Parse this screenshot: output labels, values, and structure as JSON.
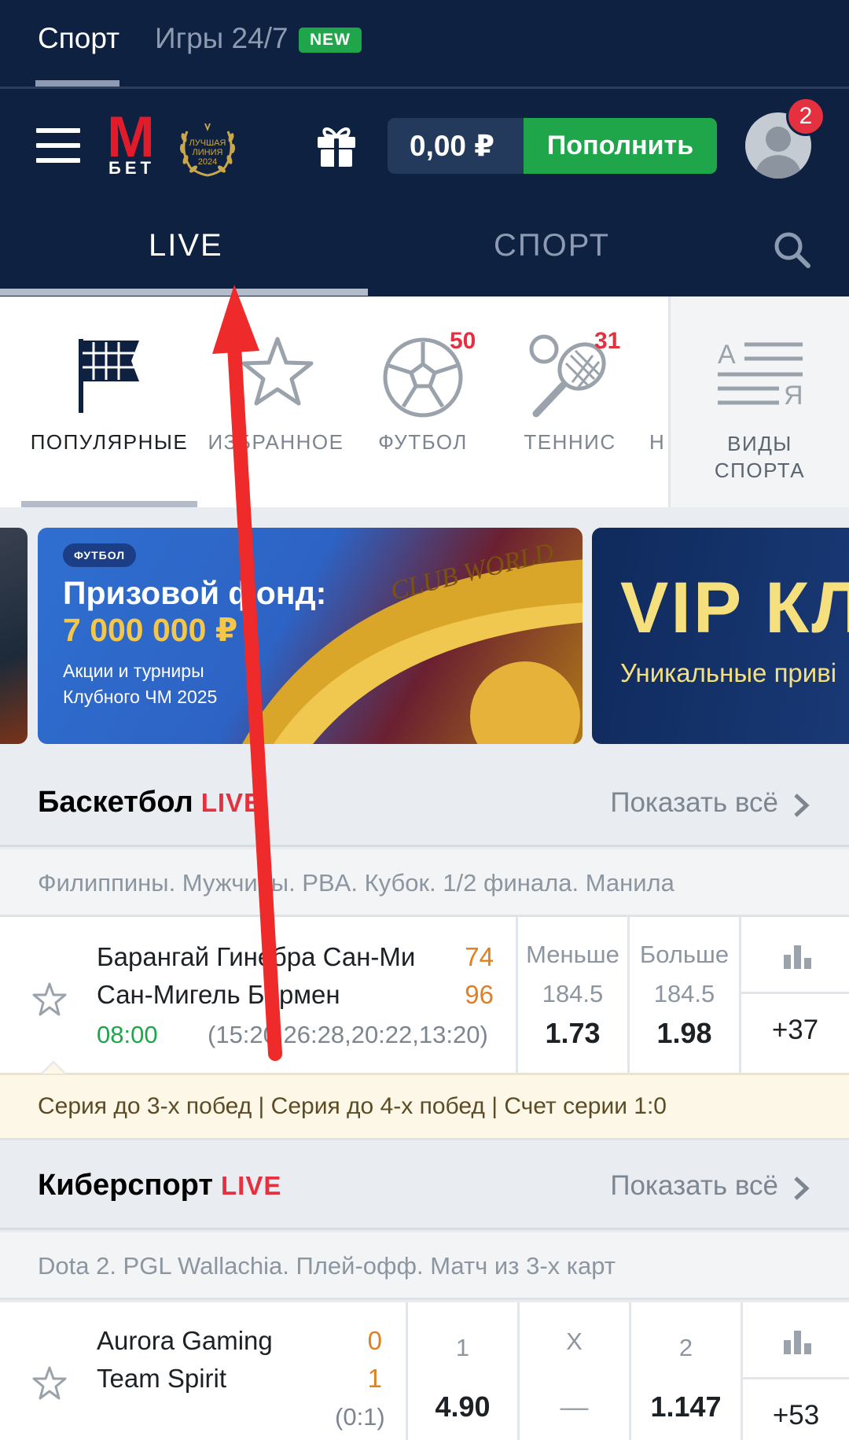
{
  "top_tabs": {
    "sport": "Спорт",
    "games": "Игры 24/7",
    "new_badge": "NEW"
  },
  "header": {
    "logo_m": "M",
    "logo_bet": "БЕТ",
    "award_text": "ЛУЧШАЯ ЛИНИЯ 2024",
    "balance": "0,00 ₽",
    "deposit_label": "Пополнить",
    "notification_count": "2",
    "tab_live": "LIVE",
    "tab_sport": "СПОРТ"
  },
  "sport_chips": [
    {
      "label": "ПОПУЛЯРНЫЕ",
      "icon": "flag-icon",
      "count": "",
      "active": true
    },
    {
      "label": "ИЗБРАННОЕ",
      "icon": "star-icon",
      "count": "",
      "active": false
    },
    {
      "label": "ФУТБОЛ",
      "icon": "football-icon",
      "count": "50",
      "active": false
    },
    {
      "label": "ТЕННИС",
      "icon": "tennis-icon",
      "count": "31",
      "active": false
    },
    {
      "label": "Н",
      "icon": "",
      "count": "",
      "active": false
    }
  ],
  "sport_kinds": {
    "line1": "ВИДЫ",
    "line2": "СПОРТА",
    "icon": "a-z-list-icon"
  },
  "banners": {
    "main": {
      "tag": "ФУТБОЛ",
      "title": "Призовой фонд:",
      "amount": "7 000 000 ₽",
      "sub1": "Акции и турниры",
      "sub2": "Клубного ЧМ 2025",
      "trophy_text": "CLUB WORLD"
    },
    "vip": {
      "title": "VIP КЛ",
      "sub": "Уникальные приві"
    }
  },
  "sections": [
    {
      "title": "Баскетбол",
      "live": "LIVE",
      "show_all": "Показать всё",
      "league": "Филиппины. Мужчины. PBA. Кубок. 1/2 финала. Манила",
      "event": {
        "team1": "Барангай Гинебра Сан-Ми",
        "team2": "Сан-Мигель Бирмен",
        "score1": "74",
        "score2": "96",
        "time": "08:00",
        "sets": "(15:20,26:28,20:22,13:20)",
        "odds": [
          {
            "head": "Меньше",
            "head2": "184.5",
            "value": "1.73"
          },
          {
            "head": "Больше",
            "head2": "184.5",
            "value": "1.98"
          }
        ],
        "more": "+37"
      },
      "series_info": "Серия до 3-х побед | Серия до 4-х побед | Счет серии 1:0"
    },
    {
      "title": "Киберспорт",
      "live": "LIVE",
      "show_all": "Показать всё",
      "league": "Dota 2. PGL Wallachia. Плей-офф. Матч из 3-х карт",
      "event": {
        "team1": "Aurora Gaming",
        "team2": "Team Spirit",
        "score1": "0",
        "score2": "1",
        "sets": "(0:1)",
        "odds": [
          {
            "head": "1",
            "value": "4.90"
          },
          {
            "head": "X",
            "value": "—"
          },
          {
            "head": "2",
            "value": "1.147"
          }
        ],
        "more": "+53"
      }
    }
  ],
  "colors": {
    "header_bg": "#0e2140",
    "accent_green": "#1fa64b",
    "accent_red": "#e5313f",
    "score_orange": "#e08020"
  }
}
